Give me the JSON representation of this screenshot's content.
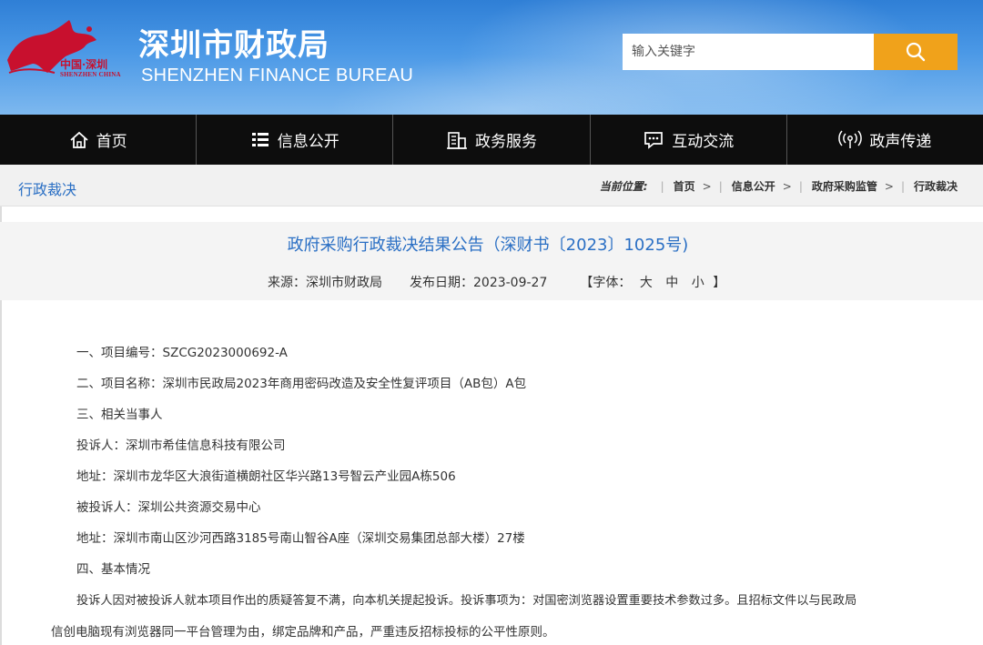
{
  "header": {
    "logo_cn": "中国·深圳",
    "logo_en": "SHENZHEN CHINA",
    "title": "深圳市财政局",
    "subtitle": "SHENZHEN FINANCE BUREAU",
    "search": {
      "placeholder": "输入关键字",
      "button_icon": "search-icon"
    }
  },
  "nav": [
    {
      "label": "首页",
      "icon": "home-icon"
    },
    {
      "label": "信息公开",
      "icon": "list-icon"
    },
    {
      "label": "政务服务",
      "icon": "building-icon"
    },
    {
      "label": "互动交流",
      "icon": "chat-icon"
    },
    {
      "label": "政声传递",
      "icon": "broadcast-icon"
    }
  ],
  "breadcrumb": {
    "section": "行政裁决",
    "location_label": "当前位置:",
    "items": [
      "首页",
      "信息公开",
      "政府采购监管",
      "行政裁决"
    ],
    "separator": ">"
  },
  "article": {
    "title": "政府采购行政裁决结果公告（深财书〔2023〕1025号)",
    "source": "来源：深圳市财政局",
    "date": "发布日期：2023-09-27",
    "font_size_label": "【字体：",
    "font_sizes": [
      "大",
      "中",
      "小"
    ],
    "font_size_close": "】",
    "paragraphs": [
      "一、项目编号：SZCG2023000692-A",
      "二、项目名称：深圳市民政局2023年商用密码改造及安全性复评项目（AB包）A包",
      "三、相关当事人",
      "投诉人：深圳市希佳信息科技有限公司",
      "地址：深圳市龙华区大浪街道横朗社区华兴路13号智云产业园A栋506",
      "被投诉人：深圳公共资源交易中心",
      "地址：深圳市南山区沙河西路3185号南山智谷A座（深圳交易集团总部大楼）27楼",
      "四、基本情况",
      "投诉人因对被投诉人就本项目作出的质疑答复不满，向本机关提起投诉。投诉事项为：对国密浏览器设置重要技术参数过多。且招标文件以与民政局",
      "信创电脑现有浏览器同一平台管理为由，绑定品牌和产品，严重违反招标投标的公平性原则。"
    ]
  },
  "colors": {
    "header_blue": "#2f7fd6",
    "search_button": "#f0a21b",
    "nav_bg": "#0d0d0d",
    "link_blue": "#2a6fc4",
    "logo_red": "#c8102e"
  }
}
